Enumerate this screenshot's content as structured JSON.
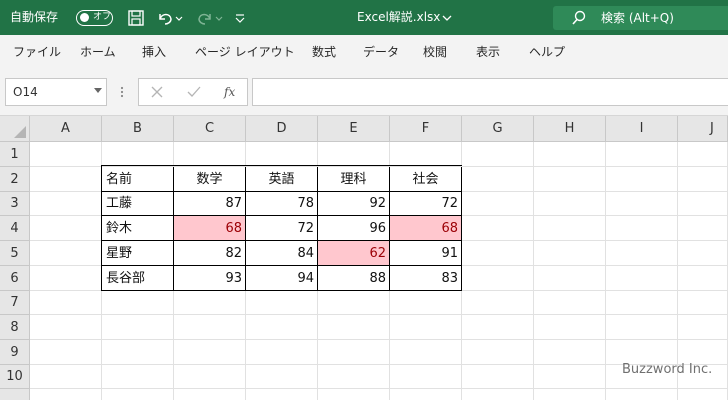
{
  "titlebar": {
    "autosave_label": "自動保存",
    "toggle_state": "オフ",
    "file_name": "Excel解説.xlsx",
    "search_text": "検索 (Alt+Q)",
    "bg_color": "#217346"
  },
  "ribbon_tabs": [
    "ファイル",
    "ホーム",
    "挿入",
    "ページ レイアウト",
    "数式",
    "データ",
    "校閲",
    "表示",
    "ヘルプ"
  ],
  "formula_bar": {
    "name_box": "O14",
    "fx_label": "fx",
    "formula": ""
  },
  "sheet": {
    "columns": [
      "A",
      "B",
      "C",
      "D",
      "E",
      "F",
      "G",
      "H",
      "I",
      "J"
    ],
    "rows": [
      "1",
      "2",
      "3",
      "4",
      "5",
      "6",
      "7",
      "8",
      "9",
      "10"
    ],
    "table": {
      "header": [
        "名前",
        "数学",
        "英語",
        "理科",
        "社会"
      ],
      "rows": [
        [
          "工藤",
          "87",
          "78",
          "92",
          "72"
        ],
        [
          "鈴木",
          "68",
          "72",
          "96",
          "68"
        ],
        [
          "星野",
          "82",
          "84",
          "62",
          "91"
        ],
        [
          "長谷部",
          "93",
          "94",
          "88",
          "83"
        ]
      ]
    },
    "highlight_color": "#ffc7ce"
  },
  "watermark": "Buzzword Inc."
}
